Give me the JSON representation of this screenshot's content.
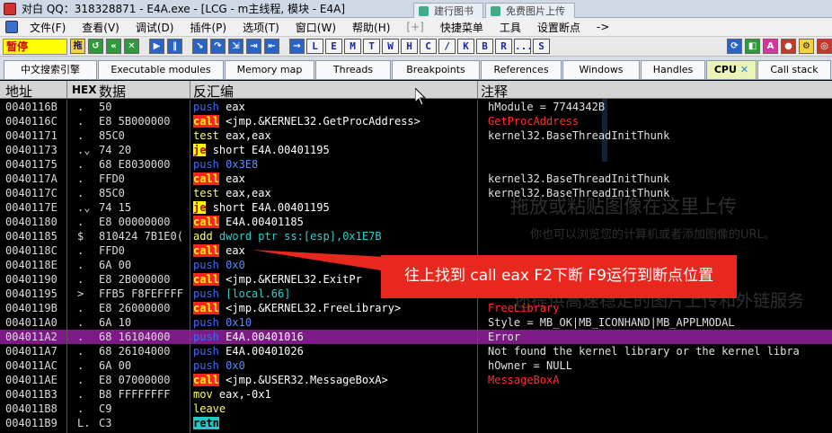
{
  "window": {
    "title": "对白 QQ：318328871 - E4A.exe - [LCG - m主线程, 模块 - E4A]",
    "browser_tabs": [
      "建行图书",
      "免费图片上传"
    ]
  },
  "menu": {
    "items": [
      "文件(F)",
      "查看(V)",
      "调试(D)",
      "插件(P)",
      "选项(T)",
      "窗口(W)",
      "帮助(H)",
      "[+]",
      "快捷菜单",
      "工具",
      "设置断点",
      "->"
    ]
  },
  "toolbar": {
    "status": "暂停",
    "letter_buttons": [
      "L",
      "E",
      "M",
      "T",
      "W",
      "H",
      "C",
      "/",
      "K",
      "B",
      "R",
      "...",
      "S"
    ]
  },
  "window_tabs": [
    {
      "label": "中文搜索引擎"
    },
    {
      "label": "Executable modules"
    },
    {
      "label": "Memory map"
    },
    {
      "label": "Threads"
    },
    {
      "label": "Breakpoints"
    },
    {
      "label": "References"
    },
    {
      "label": "Windows"
    },
    {
      "label": "Handles"
    },
    {
      "label": "CPU",
      "close": "✕"
    },
    {
      "label": "Call stack"
    }
  ],
  "columns": {
    "address": "地址",
    "hex_flag": "HEX",
    "hex": "数据",
    "disasm": "反汇编",
    "comment": "注释"
  },
  "rows": [
    {
      "addr": "0040116B",
      "mark": ".",
      "hex": "50",
      "op": "push",
      "arg": "eax",
      "com": "hModule = 7744342B",
      "opc": "k-push",
      "comc": "com-w"
    },
    {
      "addr": "0040116C",
      "mark": ".",
      "hex": "E8 5B000000",
      "op": "call",
      "arg": "<jmp.&KERNEL32.GetProcAddress>",
      "com": "GetProcAddress",
      "opc": "k-call",
      "comc": "com-red"
    },
    {
      "addr": "00401171",
      "mark": ".",
      "hex": "85C0",
      "op": "test",
      "arg": "eax,eax",
      "com": "kernel32.BaseThreadInitThunk",
      "opc": "k-test",
      "comc": "com-w"
    },
    {
      "addr": "00401173",
      "mark": ".⌄",
      "hex": "74 20",
      "op": "je",
      "arg": "short E4A.00401195",
      "com": "",
      "opc": "k-je",
      "comc": "com-w"
    },
    {
      "addr": "00401175",
      "mark": ".",
      "hex": "68 E8030000",
      "op": "push",
      "arg": "0x3E8",
      "com": "",
      "opc": "k-push",
      "comc": "com-w",
      "argc": "arg-blue"
    },
    {
      "addr": "0040117A",
      "mark": ".",
      "hex": "FFD0",
      "op": "call",
      "arg": "eax",
      "com": "kernel32.BaseThreadInitThunk",
      "opc": "k-call",
      "comc": "com-w"
    },
    {
      "addr": "0040117C",
      "mark": ".",
      "hex": "85C0",
      "op": "test",
      "arg": "eax,eax",
      "com": "kernel32.BaseThreadInitThunk",
      "opc": "k-test",
      "comc": "com-w"
    },
    {
      "addr": "0040117E",
      "mark": ".⌄",
      "hex": "74 15",
      "op": "je",
      "arg": "short E4A.00401195",
      "com": "",
      "opc": "k-je",
      "comc": "com-w"
    },
    {
      "addr": "00401180",
      "mark": ".",
      "hex": "E8 00000000",
      "op": "call",
      "arg": "E4A.00401185",
      "com": "",
      "opc": "k-call",
      "comc": "com-w"
    },
    {
      "addr": "00401185",
      "mark": "$",
      "hex": "810424 7B1E0(",
      "op": "add",
      "arg": "dword ptr ss:[esp],0x1E7B",
      "com": "",
      "opc": "k-add",
      "comc": "com-w",
      "argc": "arg-cyan"
    },
    {
      "addr": "0040118C",
      "mark": ".",
      "hex": "FFD0",
      "op": "call",
      "arg": "eax",
      "com": "",
      "opc": "k-call",
      "comc": "com-w"
    },
    {
      "addr": "0040118E",
      "mark": ".",
      "hex": "6A 00",
      "op": "push",
      "arg": "0x0",
      "com": "",
      "opc": "k-push",
      "comc": "com-w",
      "argc": "arg-blue"
    },
    {
      "addr": "00401190",
      "mark": ".",
      "hex": "E8 2B000000",
      "op": "call",
      "arg": "<jmp.&KERNEL32.ExitPr",
      "com": "",
      "opc": "k-call",
      "comc": "com-w"
    },
    {
      "addr": "00401195",
      "mark": ">",
      "hex": "FFB5 F8FEFFFF",
      "op": "push",
      "arg": "[local.66]",
      "com": "",
      "opc": "k-push",
      "comc": "com-w",
      "argc": "arg-cyan"
    },
    {
      "addr": "0040119B",
      "mark": ".",
      "hex": "E8 26000000",
      "op": "call",
      "arg": "<jmp.&KERNEL32.FreeLibrary>",
      "com": "FreeLibrary",
      "opc": "k-call",
      "comc": "com-red"
    },
    {
      "addr": "004011A0",
      "mark": ".",
      "hex": "6A 10",
      "op": "push",
      "arg": "0x10",
      "com": "Style = MB_OK|MB_ICONHAND|MB_APPLMODAL",
      "opc": "k-push",
      "comc": "com-w",
      "argc": "arg-blue"
    },
    {
      "addr": "004011A2",
      "mark": ".",
      "hex": "68 16104000",
      "op": "push",
      "arg": "E4A.00401016",
      "com": "Error",
      "opc": "k-push",
      "comc": "com-w",
      "sel": true
    },
    {
      "addr": "004011A7",
      "mark": ".",
      "hex": "68 26104000",
      "op": "push",
      "arg": "E4A.00401026",
      "com": "Not found the kernel library or the kernel libra",
      "opc": "k-push",
      "comc": "com-w"
    },
    {
      "addr": "004011AC",
      "mark": ".",
      "hex": "6A 00",
      "op": "push",
      "arg": "0x0",
      "com": "hOwner = NULL",
      "opc": "k-push",
      "comc": "com-w",
      "argc": "arg-blue"
    },
    {
      "addr": "004011AE",
      "mark": ".",
      "hex": "E8 07000000",
      "op": "call",
      "arg": "<jmp.&USER32.MessageBoxA>",
      "com": "MessageBoxA",
      "opc": "k-call",
      "comc": "com-red"
    },
    {
      "addr": "004011B3",
      "mark": ".",
      "hex": "B8 FFFFFFFF",
      "op": "mov",
      "arg": "eax,-0x1",
      "com": "",
      "opc": "k-mov",
      "comc": "com-w"
    },
    {
      "addr": "004011B8",
      "mark": ".",
      "hex": "C9",
      "op": "leave",
      "arg": "",
      "com": "",
      "opc": "k-leave",
      "comc": "com-w"
    },
    {
      "addr": "004011B9",
      "mark": "L.",
      "hex": "C3",
      "op": "retn",
      "arg": "",
      "com": "",
      "opc": "k-retn",
      "comc": "com-w"
    }
  ],
  "overlay": {
    "tip": "往上找到 call eax F2下断 F9运行到断点位置",
    "watermark1": "拖放或粘贴图像在这里上传",
    "watermark2": "你也可以浏览您的计算机或者添加图像的URL。",
    "watermark3": "还提供高速稳定的图片上传和外链服务",
    "tip_color": "#e8271f"
  }
}
